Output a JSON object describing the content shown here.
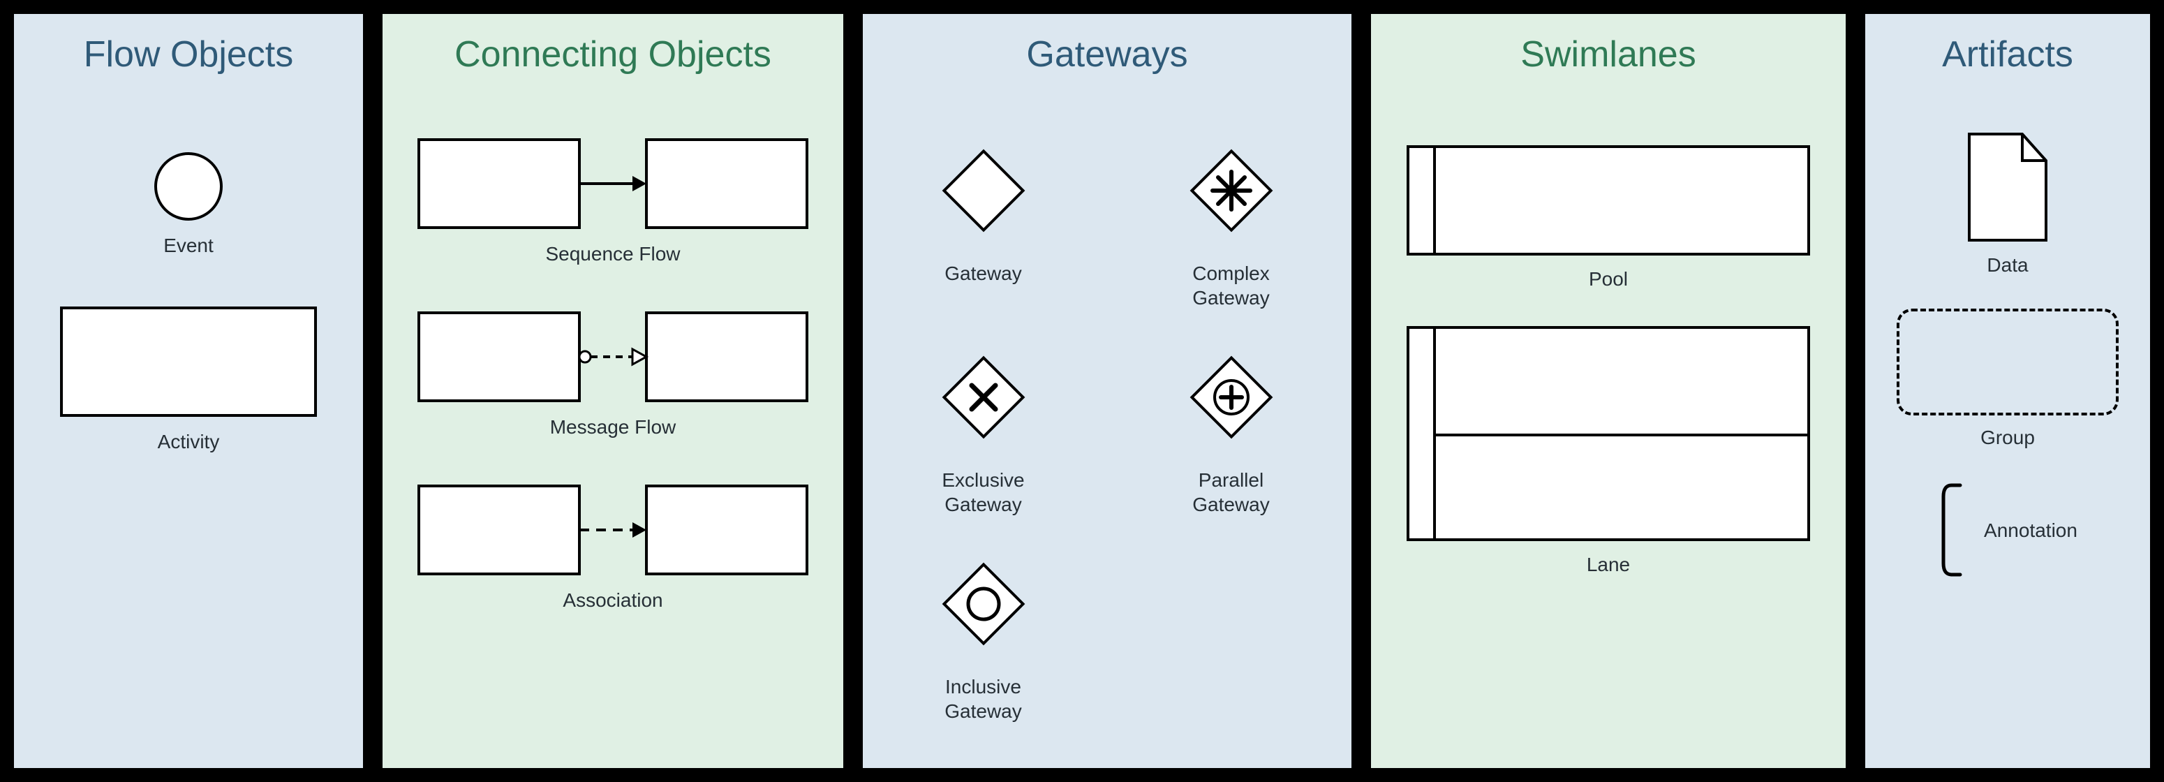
{
  "panels": {
    "flow_objects": {
      "title": "Flow Objects",
      "event": "Event",
      "activity": "Activity"
    },
    "connecting_objects": {
      "title": "Connecting Objects",
      "sequence_flow": "Sequence Flow",
      "message_flow": "Message Flow",
      "association": "Association"
    },
    "gateways": {
      "title": "Gateways",
      "gateway": "Gateway",
      "complex": "Complex\nGateway",
      "exclusive": "Exclusive\nGateway",
      "parallel": "Parallel\nGateway",
      "inclusive": "Inclusive\nGateway"
    },
    "swimlanes": {
      "title": "Swimlanes",
      "pool": "Pool",
      "lane": "Lane"
    },
    "artifacts": {
      "title": "Artifacts",
      "data": "Data",
      "group": "Group",
      "annotation": "Annotation"
    }
  },
  "colors": {
    "panel_blue": "#dce7f0",
    "panel_green": "#e0f0e4",
    "title_blue": "#2f5a78",
    "title_green": "#2f7a55",
    "shape_stroke": "#000000",
    "shape_fill": "#ffffff",
    "caption_text": "#262f36"
  }
}
